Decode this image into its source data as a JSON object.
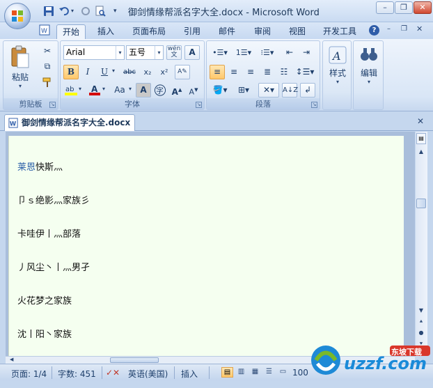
{
  "window": {
    "title": "御剑情缘帮派名字大全.docx - Microsoft Word",
    "minimize": "–",
    "restore": "❐",
    "close": "✕"
  },
  "qat": {
    "icons": [
      "save-icon",
      "undo-icon",
      "redo-icon",
      "print-preview-icon",
      "customize-qat-icon"
    ]
  },
  "tabs": [
    "开始",
    "插入",
    "页面布局",
    "引用",
    "邮件",
    "审阅",
    "视图",
    "开发工具"
  ],
  "active_tab": "开始",
  "ribbon": {
    "clipboard": {
      "label": "剪贴板",
      "paste": "粘贴"
    },
    "font": {
      "label": "字体",
      "font_name": "Arial",
      "font_size": "五号",
      "phonetic": "wén\n文",
      "bold": "B",
      "italic": "I",
      "underline": "U",
      "strike": "abc",
      "subscript": "x₂",
      "superscript": "x²",
      "aa": "Aa",
      "char_border": "A",
      "enclose": "字",
      "grow": "A",
      "shrink": "A",
      "font_color_accent": "#d40000",
      "highlight_accent": "#ffff00"
    },
    "paragraph": {
      "label": "段落"
    },
    "styles": {
      "label": "样式"
    },
    "editing": {
      "label": "编辑"
    }
  },
  "document": {
    "tab_name": "御剑情缘帮派名字大全.docx",
    "lines": [
      {
        "prefix": "莱恩",
        "rest": "快斯灬",
        "prefix_color": "#2b5fa8"
      },
      {
        "prefix": "",
        "rest": "卩ｓ绝影灬家族彡",
        "prefix_color": "#111111"
      },
      {
        "prefix": "",
        "rest": "卡哇伊丨灬部落",
        "prefix_color": "#111111"
      },
      {
        "prefix": "",
        "rest": "丿风尘丶丨灬男孑",
        "prefix_color": "#111111"
      },
      {
        "prefix": "",
        "rest": "火花梦之家族",
        "prefix_color": "#111111"
      },
      {
        "prefix": "",
        "rest": "沈丨阳丶家族",
        "prefix_color": "#111111"
      }
    ]
  },
  "statusbar": {
    "page": "页面: 1/4",
    "words": "字数: 451",
    "language": "英语(美国)",
    "mode": "插入",
    "zoom": "100"
  },
  "watermark": {
    "text": "uzzf.com",
    "badge": "东坡下载"
  }
}
